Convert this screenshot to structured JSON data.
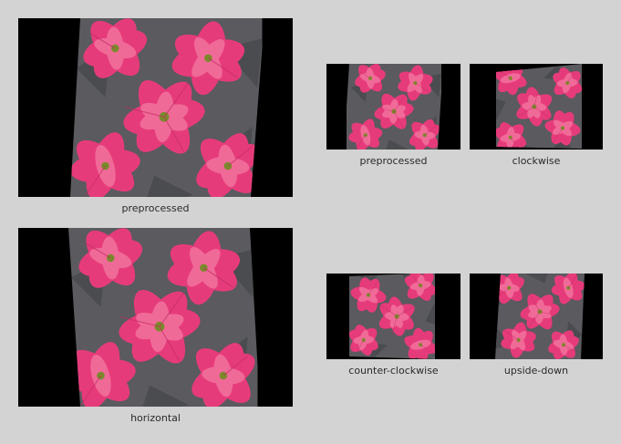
{
  "colors": {
    "background": "#d3d3d3",
    "frame": "#000000",
    "petal": "#e63b7a",
    "petal_light": "#f06a98",
    "petal_dark": "#b8245c",
    "vein": "#c02c64",
    "leaf": "#5a5a5f",
    "center": "#7a8a2a"
  },
  "panels": [
    {
      "id": "large-top",
      "caption": "preprocessed"
    },
    {
      "id": "large-bottom",
      "caption": "horizontal"
    },
    {
      "id": "small-1",
      "caption": "preprocessed"
    },
    {
      "id": "small-2",
      "caption": "clockwise"
    },
    {
      "id": "small-3",
      "caption": "counter-clockwise"
    },
    {
      "id": "small-4",
      "caption": "upside-down"
    }
  ]
}
